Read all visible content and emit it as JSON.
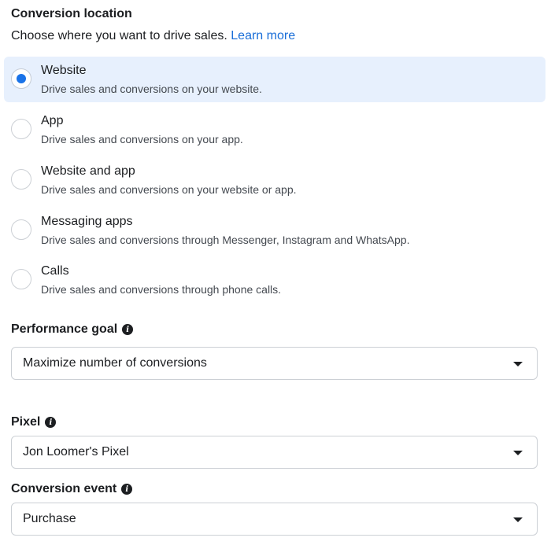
{
  "conversion_location": {
    "title": "Conversion location",
    "subtitle": "Choose where you want to drive sales.",
    "learn_more": "Learn more",
    "options": [
      {
        "label": "Website",
        "description": "Drive sales and conversions on your website.",
        "selected": true
      },
      {
        "label": "App",
        "description": "Drive sales and conversions on your app.",
        "selected": false
      },
      {
        "label": "Website and app",
        "description": "Drive sales and conversions on your website or app.",
        "selected": false
      },
      {
        "label": "Messaging apps",
        "description": "Drive sales and conversions through Messenger, Instagram and WhatsApp.",
        "selected": false
      },
      {
        "label": "Calls",
        "description": "Drive sales and conversions through phone calls.",
        "selected": false
      }
    ]
  },
  "performance_goal": {
    "title": "Performance goal",
    "value": "Maximize number of conversions"
  },
  "pixel": {
    "title": "Pixel",
    "value": "Jon Loomer's Pixel"
  },
  "conversion_event": {
    "title": "Conversion event",
    "value": "Purchase"
  },
  "icons": {
    "info": "info-icon",
    "dropdown": "caret-down-icon",
    "radio_selected": "radio-selected-icon",
    "radio_unselected": "radio-unselected-icon"
  },
  "colors": {
    "accent": "#1a73e8",
    "link": "#1a6ed8",
    "selected_bg": "#e7f0fd",
    "border": "#ccd0d5"
  }
}
